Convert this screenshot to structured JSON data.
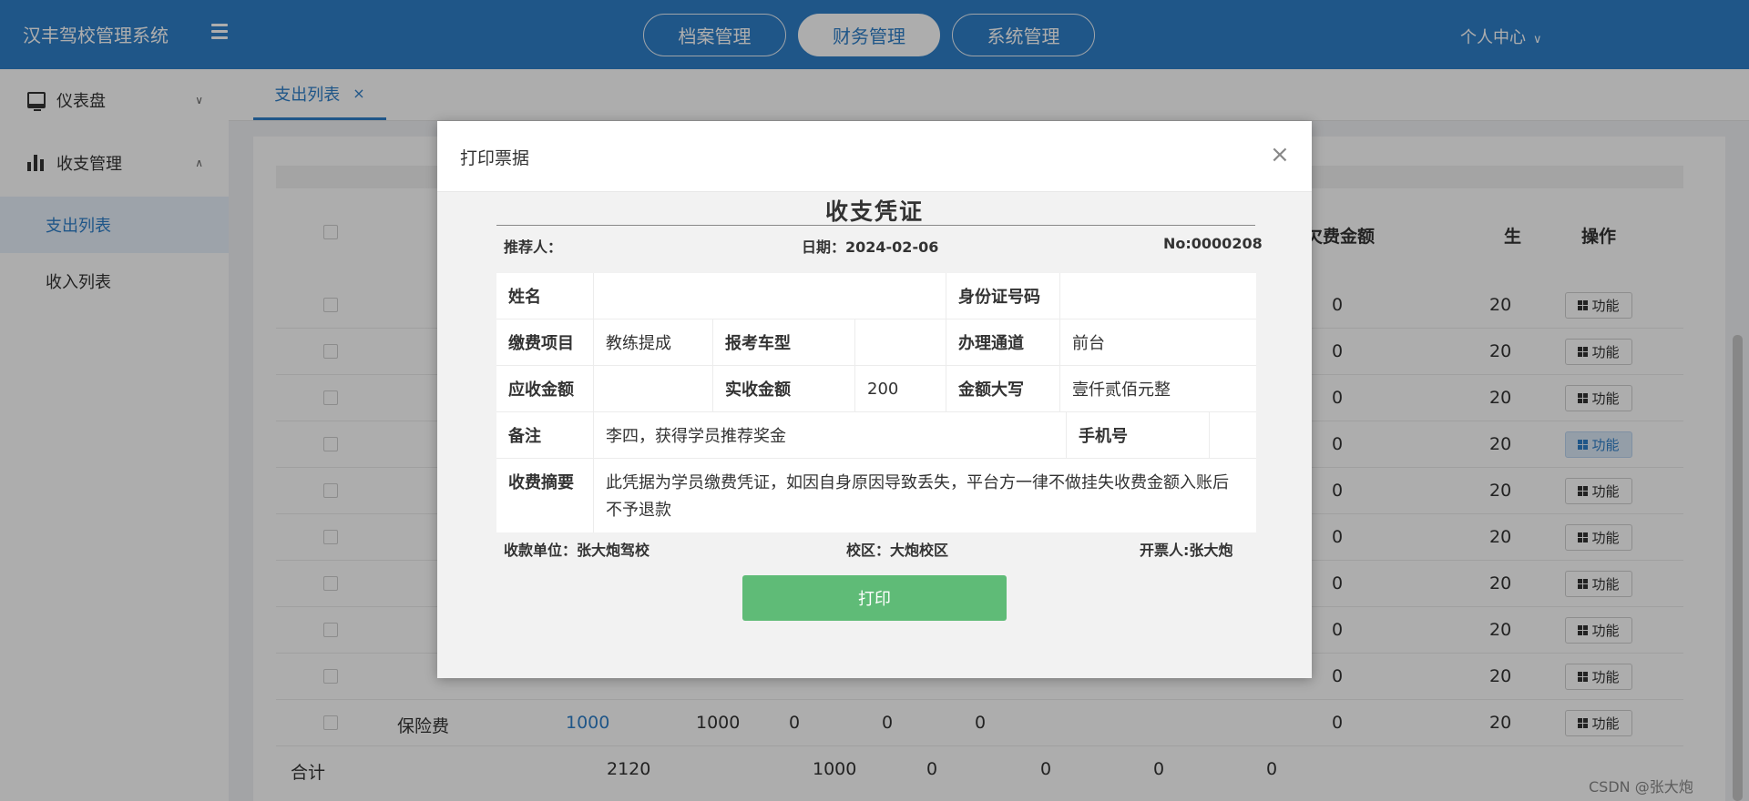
{
  "header": {
    "brand": "汉丰驾校管理系统",
    "nav": [
      {
        "label": "档案管理",
        "active": false
      },
      {
        "label": "财务管理",
        "active": true
      },
      {
        "label": "系统管理",
        "active": false
      }
    ],
    "user_center": "个人中心"
  },
  "sidebar": {
    "dashboard": "仪表盘",
    "finance": "收支管理",
    "sub_items": [
      {
        "label": "支出列表",
        "active": true
      },
      {
        "label": "收入列表",
        "active": false
      }
    ]
  },
  "tabs": [
    {
      "label": "支出列表",
      "close": "×"
    }
  ],
  "table": {
    "headers": {
      "fee": "欠费金额",
      "time": "生",
      "ops": "操作"
    },
    "rows": [
      {
        "name": "",
        "amount": "",
        "c3": "",
        "c4": "",
        "c5": "",
        "c6": "",
        "fee": "0",
        "time": "20",
        "fn": "功能"
      },
      {
        "name": "",
        "amount": "",
        "c3": "",
        "c4": "",
        "c5": "",
        "c6": "",
        "fee": "0",
        "time": "20",
        "fn": "功能"
      },
      {
        "name": "",
        "amount": "",
        "c3": "",
        "c4": "",
        "c5": "",
        "c6": "",
        "fee": "0",
        "time": "20",
        "fn": "功能"
      },
      {
        "name": "",
        "amount": "",
        "c3": "",
        "c4": "",
        "c5": "",
        "c6": "",
        "fee": "0",
        "time": "20",
        "fn": "功能"
      },
      {
        "name": "",
        "amount": "",
        "c3": "",
        "c4": "",
        "c5": "",
        "c6": "",
        "fee": "0",
        "time": "20",
        "fn": "功能"
      },
      {
        "name": "",
        "amount": "",
        "c3": "",
        "c4": "",
        "c5": "",
        "c6": "",
        "fee": "0",
        "time": "20",
        "fn": "功能"
      },
      {
        "name": "",
        "amount": "",
        "c3": "",
        "c4": "",
        "c5": "",
        "c6": "",
        "fee": "0",
        "time": "20",
        "fn": "功能"
      },
      {
        "name": "",
        "amount": "",
        "c3": "",
        "c4": "",
        "c5": "",
        "c6": "",
        "fee": "0",
        "time": "20",
        "fn": "功能"
      },
      {
        "name": "",
        "amount": "",
        "c3": "",
        "c4": "",
        "c5": "",
        "c6": "",
        "fee": "0",
        "time": "20",
        "fn": "功能"
      },
      {
        "name": "保险费",
        "amount": "1000",
        "c3": "1000",
        "c4": "0",
        "c5": "0",
        "c6": "0",
        "fee": "0",
        "time": "20",
        "fn": "功能"
      }
    ],
    "total": {
      "label": "合计",
      "amount": "2120",
      "c3": "1000",
      "c4": "0",
      "c5": "0",
      "c6": "0",
      "fee": "0"
    }
  },
  "modal": {
    "title": "打印票据",
    "close": "×",
    "voucher_title": "收支凭证",
    "referrer_label": "推荐人：",
    "date": "日期：2024-02-06",
    "no": "No:0000208",
    "rows": {
      "name_label": "姓名",
      "name_value": "",
      "id_label": "身份证号码",
      "id_value": "",
      "item_label": "缴费项目",
      "item_value": "教练提成",
      "car_label": "报考车型",
      "car_value": "",
      "channel_label": "办理通道",
      "channel_value": "前台",
      "receivable_label": "应收金额",
      "receivable_value": "",
      "actual_label": "实收金额",
      "actual_value": "200",
      "capital_label": "金额大写",
      "capital_value": "壹仟贰佰元整",
      "remark_label": "备注",
      "remark_value": "李四，获得学员推荐奖金",
      "phone_label": "手机号",
      "phone_value": "",
      "summary_label": "收费摘要",
      "summary_value": "此凭据为学员缴费凭证，如因自身原因导致丢失，平台方一律不做挂失收费金额入账后不予退款"
    },
    "payee": "收款单位：张大炮驾校",
    "campus": "校区：大炮校区",
    "issuer": "开票人:张大炮",
    "print_label": "打印"
  },
  "watermark": "CSDN @张大炮"
}
